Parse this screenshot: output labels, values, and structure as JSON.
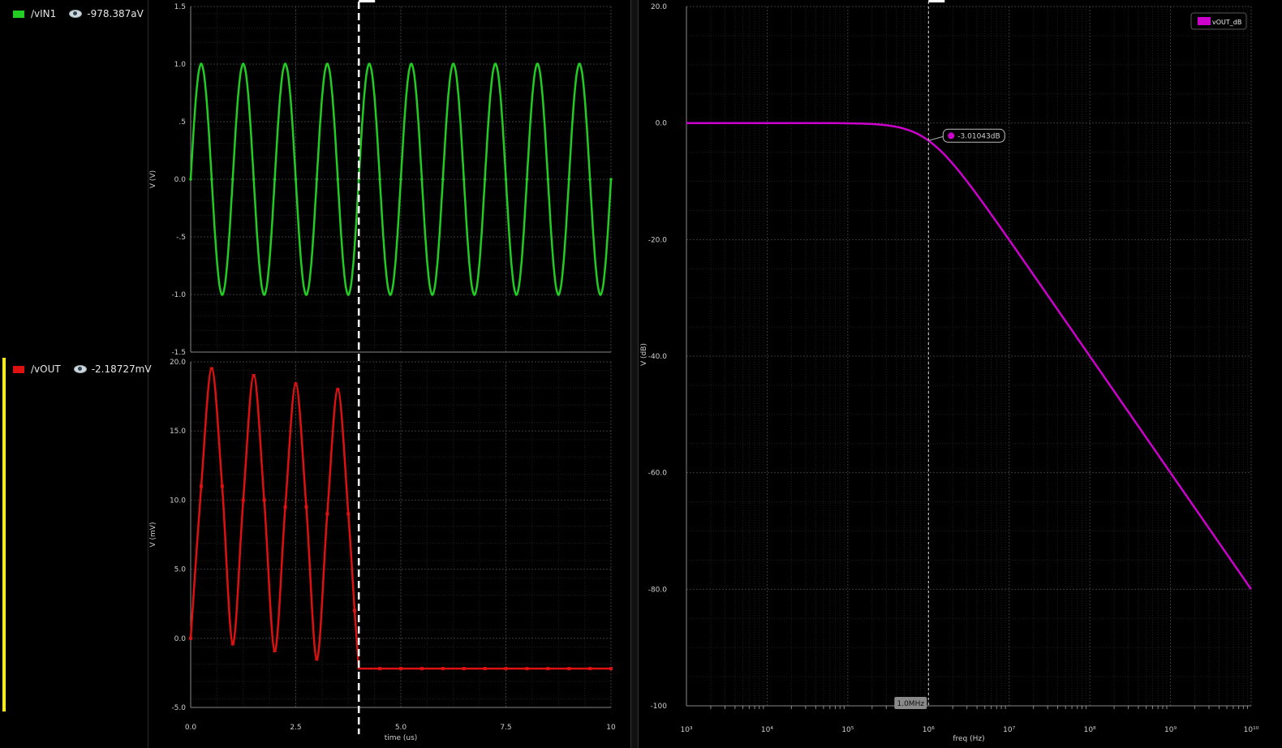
{
  "legend": {
    "signals": [
      {
        "name": "/vIN1",
        "color": "#22cc22",
        "value": "-978.387aV"
      },
      {
        "name": "/vOUT",
        "color": "#dd1111",
        "value": "-2.18727mV"
      }
    ]
  },
  "chart_data": [
    {
      "type": "line",
      "ylabel": "V (V)",
      "xlim": [
        0,
        10
      ],
      "ylim": [
        -1.5,
        1.5
      ],
      "yticks": [
        "1.5",
        "1.0",
        ".5",
        "0.0",
        "-.5",
        "-1.0",
        "-1.5"
      ],
      "series": [
        {
          "name": "/vIN1",
          "color": "#22cc22",
          "function": "sin",
          "amplitude": 1.0,
          "frequency_per_us": 1.0,
          "x_range": [
            0,
            10
          ]
        }
      ]
    },
    {
      "type": "line",
      "ylabel": "V (mV)",
      "xlabel": "time (us)",
      "xlim": [
        0,
        10
      ],
      "ylim": [
        -5,
        20
      ],
      "yticks": [
        "20.0",
        "15.0",
        "10.0",
        "5.0",
        "0.0",
        "-5.0"
      ],
      "xticks": [
        "0.0",
        "2.5",
        "5.0",
        "7.5",
        "10"
      ],
      "cursor_x": 4.0,
      "series": [
        {
          "name": "/vOUT",
          "color": "#dd1111",
          "x": [
            0,
            0.25,
            0.5,
            0.75,
            1.0,
            1.25,
            1.5,
            1.75,
            2.0,
            2.25,
            2.5,
            2.75,
            3.0,
            3.25,
            3.5,
            3.75,
            3.9,
            4.0,
            10.0
          ],
          "y": [
            0,
            11,
            19.5,
            11,
            -0.4,
            10,
            19,
            10,
            -0.9,
            9.5,
            18.4,
            9.5,
            -1.5,
            9,
            18,
            9,
            2,
            -2.19,
            -2.19
          ]
        }
      ]
    },
    {
      "type": "line",
      "xlabel": "freq (Hz)",
      "ylabel": "V (dB)",
      "xscale": "log",
      "xlim": [
        1000,
        10000000000
      ],
      "ylim": [
        -100,
        20
      ],
      "yticks": [
        "20.0",
        "0.0",
        "-20.0",
        "-40.0",
        "-60.0",
        "-80.0",
        "-100"
      ],
      "xticks": [
        "10³",
        "10⁴",
        "10⁵",
        "10⁶",
        "10⁷",
        "10⁸",
        "10⁹",
        "10¹⁰"
      ],
      "cursor_x": 1000000,
      "cursor_label": "1.0MHz",
      "marker": {
        "x": 1000000,
        "y": -3.01043,
        "label": "-3.01043dB"
      },
      "legend_position": "top-right",
      "series": [
        {
          "name": "vOUT_dB",
          "color": "#cc00cc",
          "model": "first-order low-pass",
          "corner_freq_hz": 1000000
        }
      ]
    }
  ]
}
